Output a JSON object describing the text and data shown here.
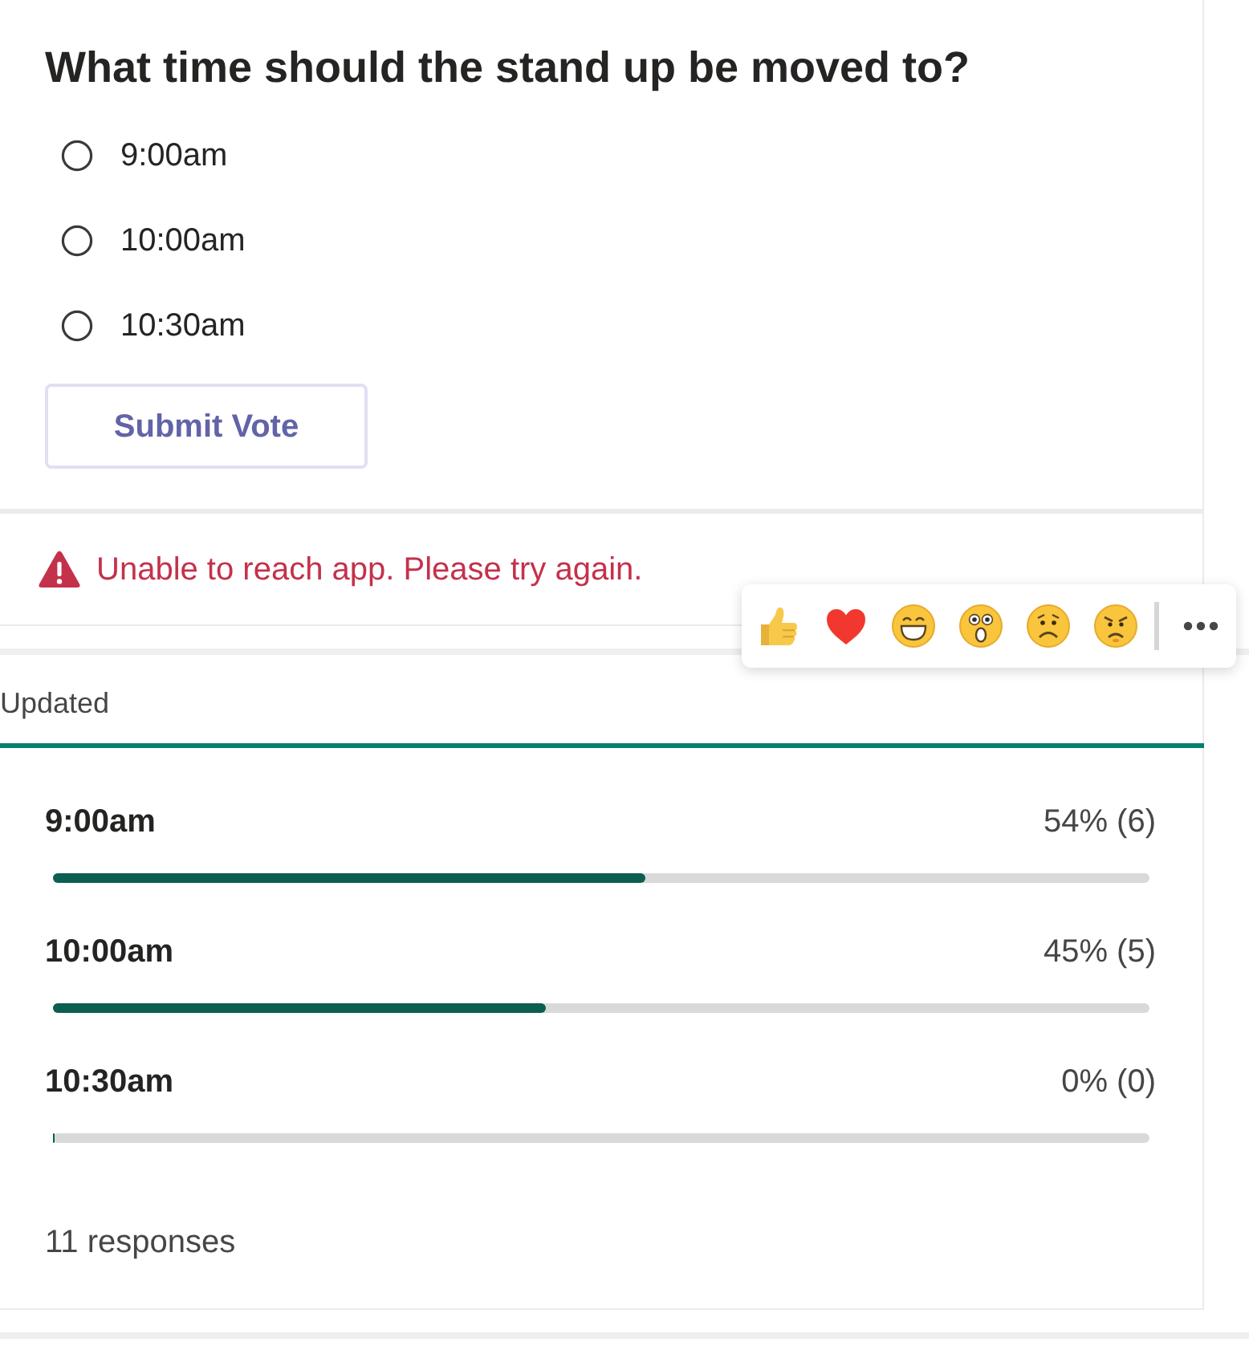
{
  "poll": {
    "question": "What time should the stand up be moved to?",
    "options": [
      {
        "label": "9:00am",
        "selected": false
      },
      {
        "label": "10:00am",
        "selected": false
      },
      {
        "label": "10:30am",
        "selected": false
      }
    ],
    "submit_button": "Submit Vote"
  },
  "error": {
    "message": "Unable to reach app. Please try again."
  },
  "reactions": [
    {
      "kind": "like"
    },
    {
      "kind": "heart"
    },
    {
      "kind": "laugh"
    },
    {
      "kind": "surprised"
    },
    {
      "kind": "sad"
    },
    {
      "kind": "angry"
    }
  ],
  "results": {
    "status": "Updated",
    "options": [
      {
        "label": "9:00am",
        "reading": "54% (6)",
        "level": 0.54
      },
      {
        "label": "10:00am",
        "reading": "45% (5)",
        "level": 0.45
      },
      {
        "label": "10:30am",
        "reading": "0% (0)",
        "level": 0
      }
    ],
    "total": "11 responses"
  }
}
